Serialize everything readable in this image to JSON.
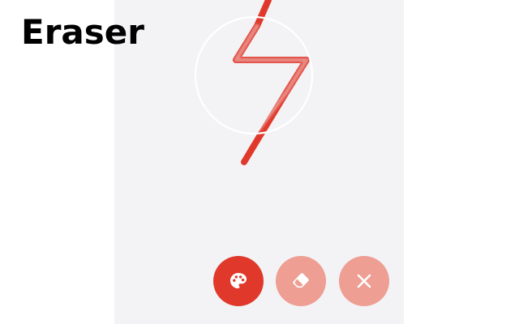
{
  "page": {
    "title": "Eraser"
  },
  "colors": {
    "canvas_background": "#f3f3f6",
    "stroke": "#e0392b",
    "active_button": "#e0392b",
    "inactive_button": "#ee9e93",
    "eraser_cursor_outline": "#ffffff"
  },
  "toolbar": {
    "buttons": [
      {
        "name": "palette-button",
        "icon": "palette-icon",
        "state": "active"
      },
      {
        "name": "eraser-button",
        "icon": "eraser-icon",
        "state": "inactive"
      },
      {
        "name": "close-button",
        "icon": "close-icon",
        "state": "inactive"
      }
    ]
  }
}
